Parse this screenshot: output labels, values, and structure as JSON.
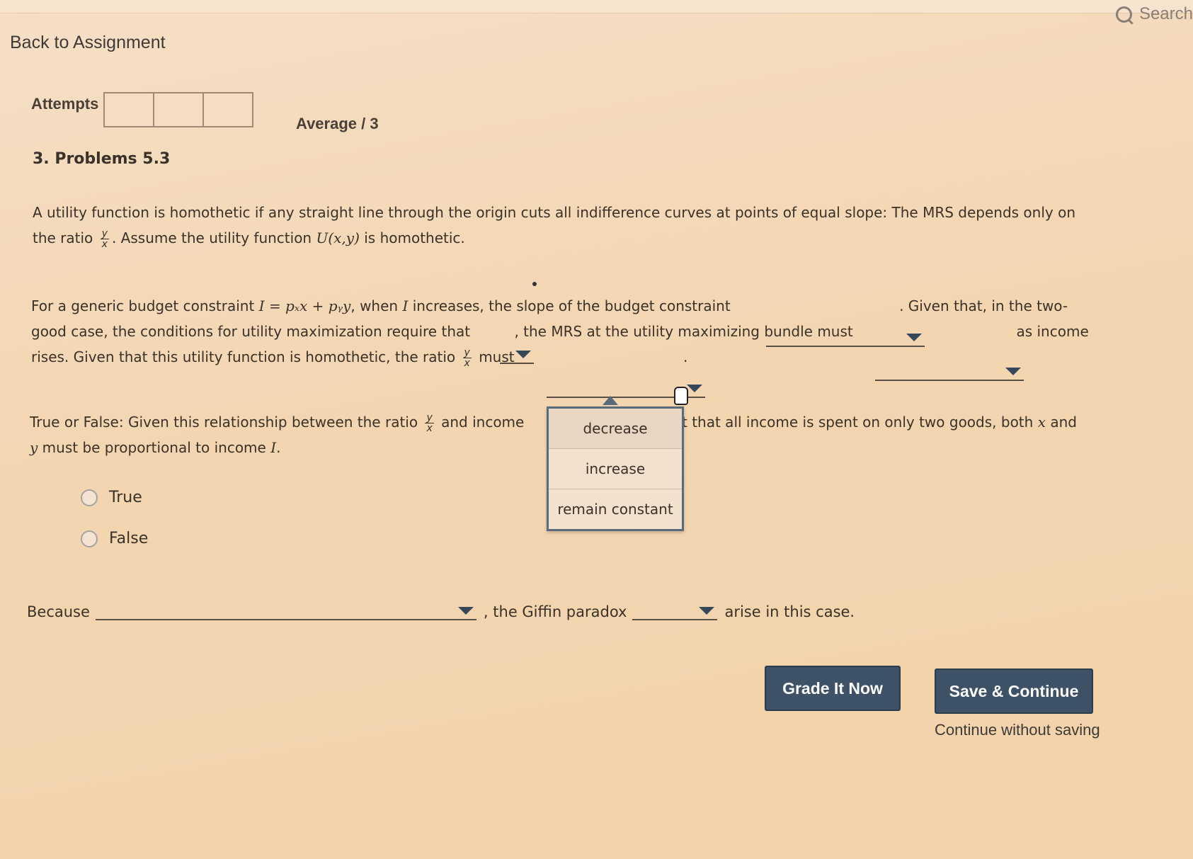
{
  "header": {
    "search_label": "Search",
    "back_link": "Back to Assignment"
  },
  "attempts": {
    "label": "Attempts",
    "boxes": [
      "",
      "",
      ""
    ],
    "average": "Average / 3"
  },
  "question": {
    "title": "3. Problems 5.3",
    "intro_a": "A utility function is homothetic if any straight line through the origin cuts all indifference curves at points of equal slope: The MRS depends only on the ratio",
    "intro_b": ". Assume the utility function",
    "intro_fn": "U(x,y)",
    "intro_c": "is homothetic.",
    "frac_num": "y",
    "frac_den": "x",
    "p2_a": "For a generic budget constraint",
    "p2_eq": "I = pₓx + pᵧy",
    "p2_b": ", when",
    "p2_i": "I",
    "p2_c": "increases, the slope of the budget constraint",
    "p2_d": ". Given that, in the two-good case, the conditions for utility maximization require that",
    "p2_e": ", the MRS at the utility maximizing bundle must",
    "p2_f": "as income rises. Given that this utility function is homothetic, the ratio",
    "p2_g": "must",
    "p2_h": ".",
    "listbox_options": [
      "decrease",
      "increase",
      "remain constant"
    ],
    "tf_a": "True or False: Given this relationship between the ratio",
    "tf_b": "and income",
    "tf_c": "fact that all income is spent on only two goods, both",
    "tf_x": "x",
    "tf_and": "and",
    "tf_y": "y",
    "tf_d": "must be proportional to income",
    "tf_i": "I",
    "tf_period": ".",
    "radio_true": "True",
    "radio_false": "False",
    "because_label": "Because",
    "giffin_label": ", the Giffin paradox",
    "arise_label": "arise in this case."
  },
  "buttons": {
    "grade": "Grade It Now",
    "save": "Save & Continue",
    "continue_without_saving": "Continue without saving"
  },
  "colors": {
    "button_bg": "#3d5266",
    "background": "#f3d5b1"
  }
}
